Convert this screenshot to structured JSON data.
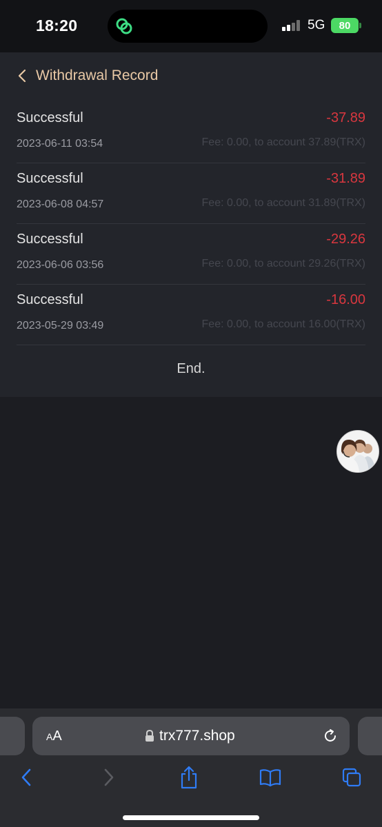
{
  "status_bar": {
    "time": "18:20",
    "network": "5G",
    "battery": "80"
  },
  "header": {
    "title": "Withdrawal Record"
  },
  "records": [
    {
      "status": "Successful",
      "amount": "-37.89",
      "date": "2023-06-11 03:54",
      "fee": "Fee: 0.00, to account 37.89(TRX)"
    },
    {
      "status": "Successful",
      "amount": "-31.89",
      "date": "2023-06-08 04:57",
      "fee": "Fee: 0.00, to account 31.89(TRX)"
    },
    {
      "status": "Successful",
      "amount": "-29.26",
      "date": "2023-06-06 03:56",
      "fee": "Fee: 0.00, to account 29.26(TRX)"
    },
    {
      "status": "Successful",
      "amount": "-16.00",
      "date": "2023-05-29 03:49",
      "fee": "Fee: 0.00, to account 16.00(TRX)"
    }
  ],
  "list_end": "End.",
  "browser": {
    "url": "trx777.shop",
    "aa_big": "A",
    "aa_small": "A"
  },
  "colors": {
    "accent": "#e9c9a6",
    "negative": "#d9373f",
    "toolbar_icon": "#2f7cf6"
  }
}
